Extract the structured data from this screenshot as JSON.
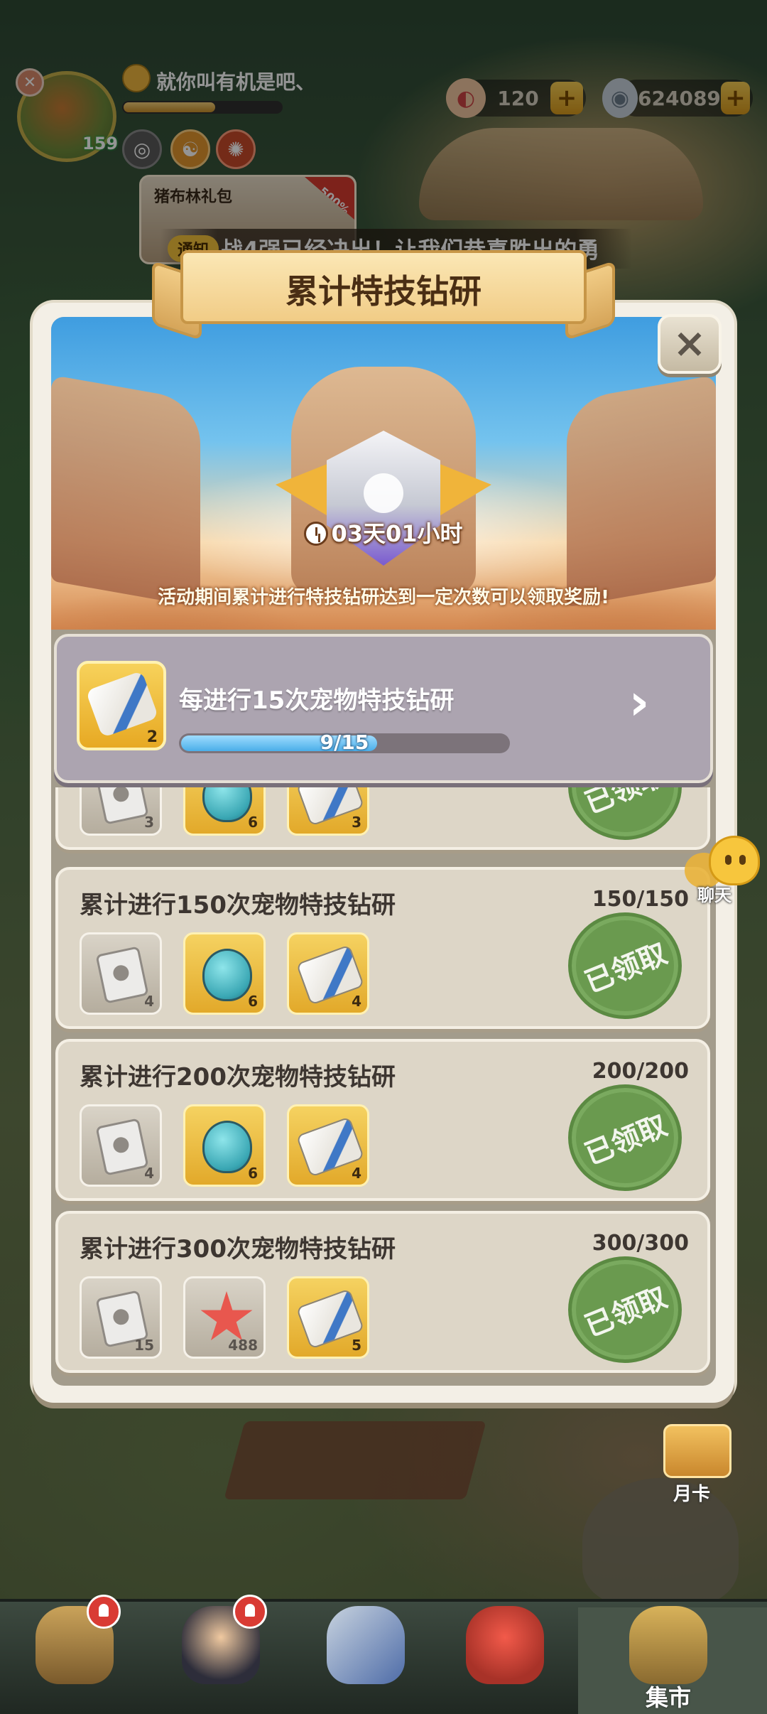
{
  "hud": {
    "player_name": "就你叫有机是吧、",
    "level": "159",
    "xp_progress": 0.58,
    "currency": [
      {
        "icon": "shell-icon",
        "value": "120",
        "plus": "+"
      },
      {
        "icon": "pearl-icon",
        "value": "624089",
        "plus": "+"
      }
    ],
    "gift_pack": {
      "title": "猪布林礼包",
      "ribbon": "500%"
    }
  },
  "notice": {
    "tag": "通知",
    "text": "战4强已经决出！让我们恭喜胜出的勇"
  },
  "panel": {
    "title": "累计特技钻研",
    "close": "×",
    "timer": "03天01小时",
    "description": "活动期间累计进行特技钻研达到一定次数可以领取奖励!"
  },
  "featured": {
    "item_icon": "scroll-icon",
    "item_qty": "2",
    "label": "每进行15次宠物特技钻研",
    "progress_text": "9/15",
    "progress": 0.6,
    "arrow": "›"
  },
  "milestones": [
    {
      "title": "",
      "count": "",
      "rewards": [
        {
          "icon": "paw-paper-icon",
          "qty": "3",
          "style": "grey"
        },
        {
          "icon": "potion-icon",
          "qty": "6",
          "style": "gold"
        },
        {
          "icon": "scroll-icon",
          "qty": "3",
          "style": "gold"
        }
      ],
      "status": "已领取"
    },
    {
      "title": "累计进行150次宠物特技钻研",
      "count": "150/150",
      "rewards": [
        {
          "icon": "paw-paper-icon",
          "qty": "4",
          "style": "grey"
        },
        {
          "icon": "potion-icon",
          "qty": "6",
          "style": "gold"
        },
        {
          "icon": "scroll-icon",
          "qty": "4",
          "style": "gold"
        }
      ],
      "status": "已领取"
    },
    {
      "title": "累计进行200次宠物特技钻研",
      "count": "200/200",
      "rewards": [
        {
          "icon": "paw-paper-icon",
          "qty": "4",
          "style": "grey"
        },
        {
          "icon": "potion-icon",
          "qty": "6",
          "style": "gold"
        },
        {
          "icon": "scroll-icon",
          "qty": "4",
          "style": "gold"
        }
      ],
      "status": "已领取"
    },
    {
      "title": "累计进行300次宠物特技钻研",
      "count": "300/300",
      "rewards": [
        {
          "icon": "paw-paper-icon",
          "qty": "15",
          "style": "grey"
        },
        {
          "icon": "starfish-icon",
          "qty": "488",
          "style": "grey"
        },
        {
          "icon": "scroll-icon",
          "qty": "5",
          "style": "gold"
        }
      ],
      "status": "已领取"
    }
  ],
  "side": {
    "chat_label": "聊天",
    "month_card_label": "月卡"
  },
  "bottom_nav": [
    {
      "icon": "caveman-icon",
      "label": "",
      "badge": true
    },
    {
      "icon": "hero-icon",
      "label": "",
      "badge": true
    },
    {
      "icon": "sword-icon",
      "label": "",
      "badge": false
    },
    {
      "icon": "dino-pet-icon",
      "label": "",
      "badge": false
    },
    {
      "icon": "totem-market-icon",
      "label": "集市",
      "badge": false
    }
  ]
}
